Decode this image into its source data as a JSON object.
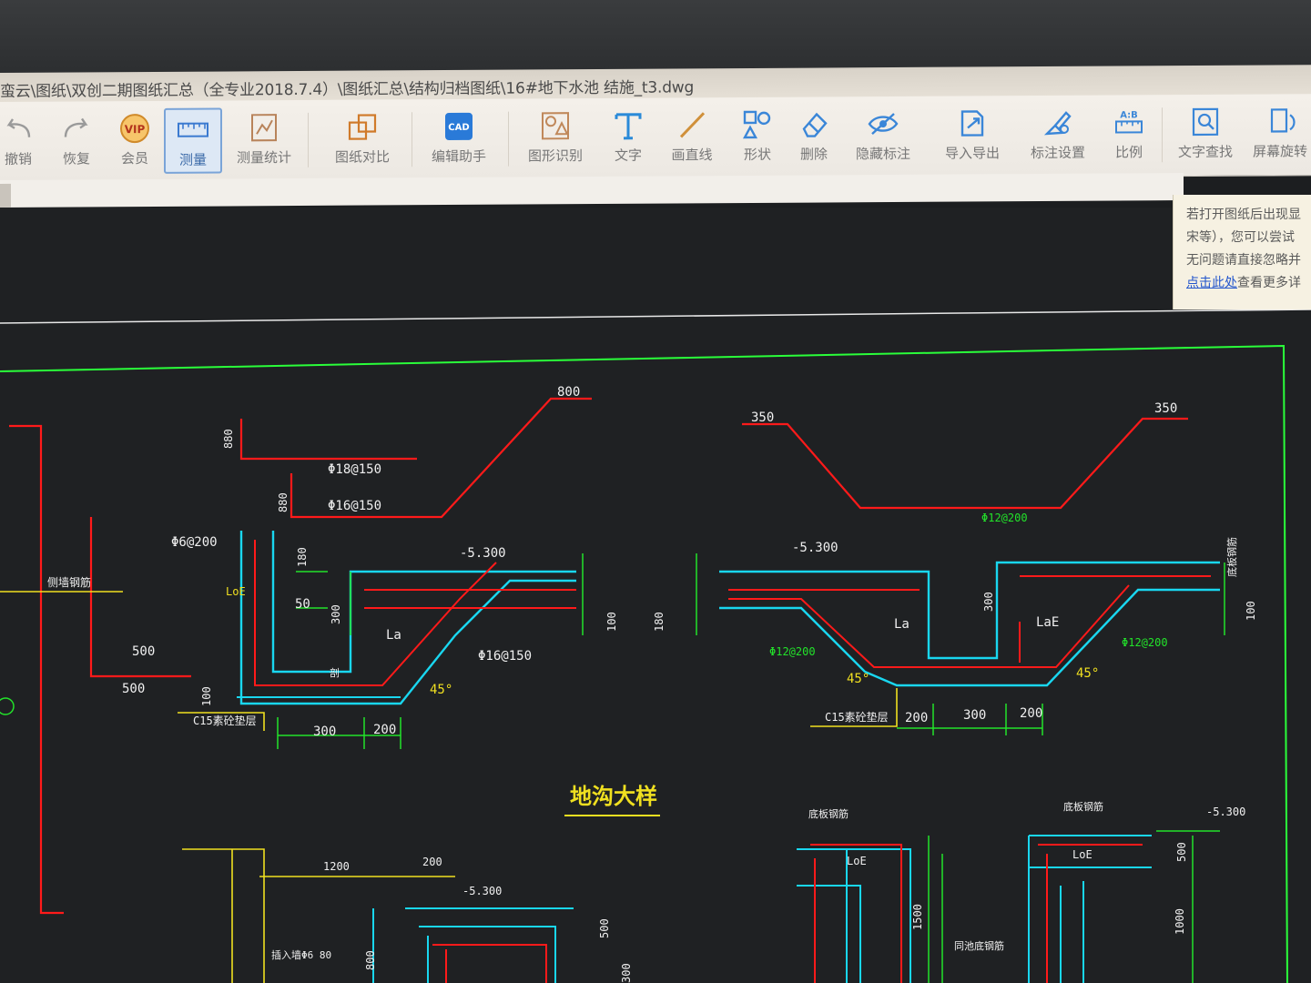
{
  "window": {
    "title": "蛮云\\图纸\\双创二期图纸汇总（全专业2018.7.4）\\图纸汇总\\结构归档图纸\\16#地下水池 结施_t3.dwg"
  },
  "toolbar": {
    "items": [
      {
        "label": "撤销",
        "icon": "undo-icon"
      },
      {
        "label": "恢复",
        "icon": "redo-icon"
      },
      {
        "label": "会员",
        "icon": "vip-icon"
      },
      {
        "label": "测量",
        "icon": "measure-icon"
      },
      {
        "label": "测量统计",
        "icon": "measure-stats-icon"
      },
      {
        "label": "图纸对比",
        "icon": "compare-icon"
      },
      {
        "label": "编辑助手",
        "icon": "cad-edit-icon"
      },
      {
        "label": "图形识别",
        "icon": "shape-recognize-icon"
      },
      {
        "label": "文字",
        "icon": "text-icon"
      },
      {
        "label": "画直线",
        "icon": "line-icon"
      },
      {
        "label": "形状",
        "icon": "shape-icon"
      },
      {
        "label": "删除",
        "icon": "eraser-icon"
      },
      {
        "label": "隐藏标注",
        "icon": "hide-eye-icon"
      },
      {
        "label": "导入导出",
        "icon": "import-export-icon"
      },
      {
        "label": "标注设置",
        "icon": "annotation-settings-icon"
      },
      {
        "label": "比例",
        "icon": "scale-icon"
      },
      {
        "label": "文字查找",
        "icon": "text-search-icon"
      },
      {
        "label": "屏幕旋转",
        "icon": "rotate-screen-icon"
      }
    ]
  },
  "notice": {
    "line1": "若打开图纸后出现显",
    "line2": "宋等），您可以尝试",
    "line3": "无问题请直接忽略并",
    "link": "点击此处",
    "link_suffix": "查看更多详"
  },
  "drawing": {
    "title": "地沟大样",
    "labels": {
      "top1": "800",
      "top2": "350",
      "top3": "350",
      "rebar1": "Φ18@150",
      "rebar2": "Φ16@150",
      "rebar3": "Φ12@200",
      "rebar4": "Φ6@200",
      "rebar5": "Φ16@150",
      "rebar6": "Φ12@200",
      "rebar7": "Φ12@200",
      "dim880a": "880",
      "dim880b": "880",
      "elev1": "-5.300",
      "elev2": "-5.300",
      "elev3": "-5.300",
      "elev4": "-5.300",
      "la1": "La",
      "la2": "La",
      "la3": "LaE",
      "lab_loe": "LoE",
      "lab_loe2": "LoE",
      "lab_loe3": "LoE",
      "angle1": "45°",
      "angle2": "45°",
      "angle3": "45°",
      "c15a": "C15素砼垫层",
      "c15b": "C15素砼垫层",
      "d180": "180",
      "d50": "50",
      "d300a": "300",
      "d100a": "100",
      "d100b": "100",
      "d100c": "100",
      "d180b": "180",
      "d300b": "300",
      "d300c": "300",
      "d200a": "200",
      "d200b": "200",
      "d300d": "300",
      "d200c": "200",
      "d500a": "500",
      "d500b": "500",
      "d1200": "1200",
      "d200d": "200",
      "d800": "800",
      "d500c": "500",
      "d1500": "1500",
      "d500d": "500",
      "d1000": "1000",
      "d300e": "300",
      "note_left": "侧墙钢筋",
      "note_b1": "底板钢筋",
      "note_b2": "底板钢筋",
      "note_b3": "底板钢筋",
      "note_mid": "同池底钢筋",
      "note_bot": "插入墙Φ6 80",
      "note_xx": "剖"
    }
  },
  "colors": {
    "red": "#ff1a1a",
    "cyan": "#19d7f0",
    "green": "#22e32a",
    "yellow": "#f0e020",
    "white": "#f0f0f0",
    "frame": "#2aff3a"
  }
}
